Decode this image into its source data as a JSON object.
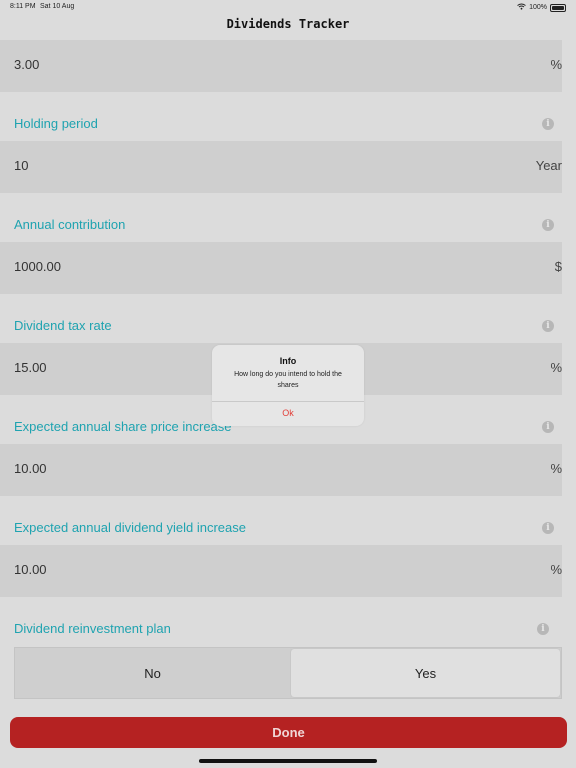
{
  "status_bar": {
    "time": "8:11 PM",
    "date": "Sat 10 Aug",
    "wifi_icon": "wifi-icon",
    "battery": "100%"
  },
  "nav": {
    "title": "Dividends Tracker"
  },
  "fields": {
    "first": {
      "value": "3.00",
      "unit": "%"
    },
    "holding_period": {
      "label": "Holding period",
      "value": "10",
      "unit": "Year"
    },
    "annual_contribution": {
      "label": "Annual contribution",
      "value": "1000.00",
      "unit": "$"
    },
    "dividend_tax_rate": {
      "label": "Dividend tax rate",
      "value": "15.00",
      "unit": "%"
    },
    "share_price_increase": {
      "label": "Expected annual share price increase",
      "value": "10.00",
      "unit": "%"
    },
    "dividend_yield_increase": {
      "label": "Expected annual dividend yield increase",
      "value": "10.00",
      "unit": "%"
    }
  },
  "reinvestment": {
    "label": "Dividend reinvestment plan",
    "options": [
      "No",
      "Yes"
    ],
    "selected": "Yes"
  },
  "done_button": "Done",
  "alert": {
    "title": "Info",
    "message": "How long do you intend to hold the shares",
    "ok": "Ok"
  },
  "colors": {
    "label": "#1fa3b0",
    "done_button": "#b52222",
    "alert_ok": "#e2403a"
  }
}
